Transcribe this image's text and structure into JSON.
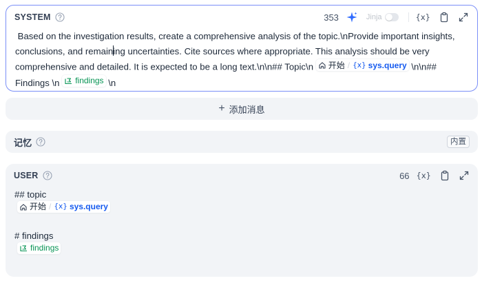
{
  "system": {
    "title": "SYSTEM",
    "count": "353",
    "jinja_label": "Jinja",
    "var_tool": "{x}",
    "prompt_before_cursor": "Based on the investigation results, create a comprehensive analysis of the topic.\\nProvide important insights, conclusions, and remain",
    "prompt_after_cursor": "ing uncertainties. Cite sources where appropriate. This analysis should be very comprehensive and detailed. It is expected to be a long text.\\n\\n## Topic\\n ",
    "start_node_label": "开始",
    "query_var": "sys.query",
    "prompt_mid": " \\n\\n## Findings \\n ",
    "findings_var": "findings",
    "prompt_end": " \\n"
  },
  "add_message": {
    "plus": "+",
    "label": "添加消息"
  },
  "memory": {
    "title": "记忆",
    "badge": "内置"
  },
  "user": {
    "title": "USER",
    "count": "66",
    "var_tool": "{x}",
    "line1": "## topic",
    "start_node_label": "开始",
    "query_var": "sys.query",
    "line3": "# findings",
    "findings_var": "findings"
  },
  "colors": {
    "accent": "#155aef",
    "green": "#079455",
    "border_active": "#7a8ef7"
  },
  "icons": [
    "help-icon",
    "sparkle-icon",
    "copy-icon",
    "expand-icon",
    "home-icon",
    "loop-icon"
  ]
}
